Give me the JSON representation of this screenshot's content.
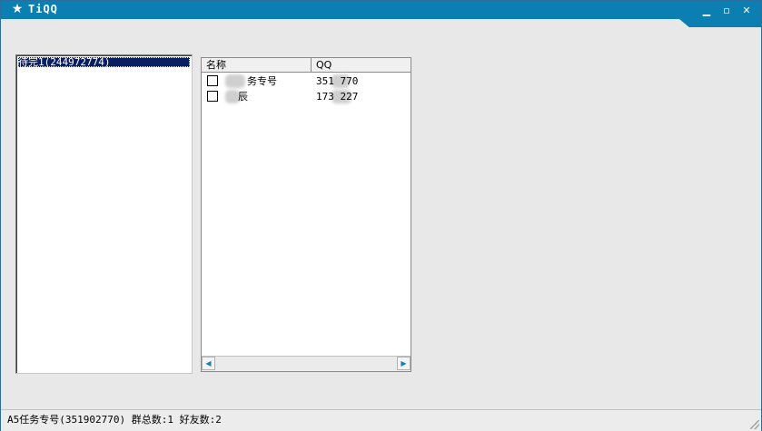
{
  "window": {
    "title": "TiQQ",
    "icon": "star-icon",
    "accent": "#0b7fb1"
  },
  "groups": {
    "items": [
      {
        "label": "待完1(244972774)"
      }
    ],
    "selected_color": "#0a1e64"
  },
  "table": {
    "columns": [
      "名称",
      "QQ"
    ],
    "rows": [
      {
        "name": "务专号",
        "qq": "351 770"
      },
      {
        "name": "辰",
        "qq": "173 227"
      }
    ]
  },
  "status": {
    "text": "A5任务专号(351902770) 群总数:1 好友数:2"
  }
}
